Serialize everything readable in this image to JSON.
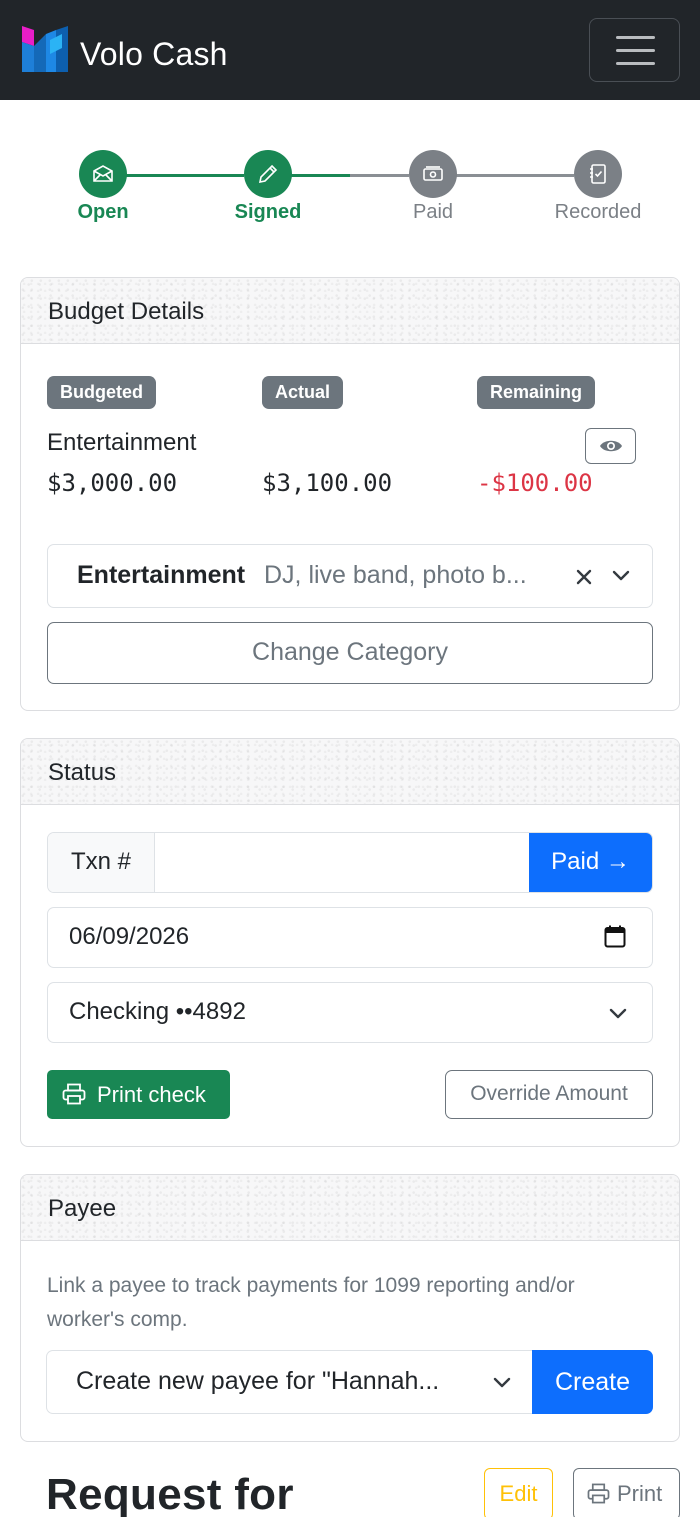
{
  "navbar": {
    "brand": "Volo Cash",
    "menu_icon": "hamburger-menu-icon"
  },
  "steps": [
    {
      "label": "Open",
      "status": "complete",
      "icon": "envelope-icon"
    },
    {
      "label": "Signed",
      "status": "complete",
      "icon": "pencil-icon"
    },
    {
      "label": "Paid",
      "status": "pending",
      "icon": "cash-icon"
    },
    {
      "label": "Recorded",
      "status": "pending",
      "icon": "journal-check-icon"
    }
  ],
  "budget": {
    "title": "Budget Details",
    "badges": {
      "budgeted": "Budgeted",
      "actual": "Actual",
      "remaining": "Remaining"
    },
    "category_name": "Entertainment",
    "budgeted_amount": "$3,000.00",
    "actual_amount": "$3,100.00",
    "remaining_amount": "-$100.00",
    "select": {
      "category": "Entertainment",
      "description": "DJ, live band, photo b..."
    },
    "change_button": "Change Category"
  },
  "status": {
    "title": "Status",
    "txn_label": "Txn #",
    "txn_value": "",
    "paid_button": "Paid →",
    "date": "06/09/2026",
    "account": "Checking ••4892",
    "print_button": "Print check",
    "override_button": "Override Amount"
  },
  "payee": {
    "title": "Payee",
    "help_text": "Link a payee to track payments for 1099 reporting and/or worker's comp.",
    "select_value": "Create new payee for \"Hannah...",
    "create_button": "Create"
  },
  "request": {
    "heading": "Request for",
    "edit_button": "Edit",
    "print_button": "Print"
  },
  "colors": {
    "success": "#198754",
    "primary": "#0d6efd",
    "danger": "#dc3545",
    "secondary": "#6c757d",
    "warning": "#ffc107",
    "navbar": "#212529"
  }
}
